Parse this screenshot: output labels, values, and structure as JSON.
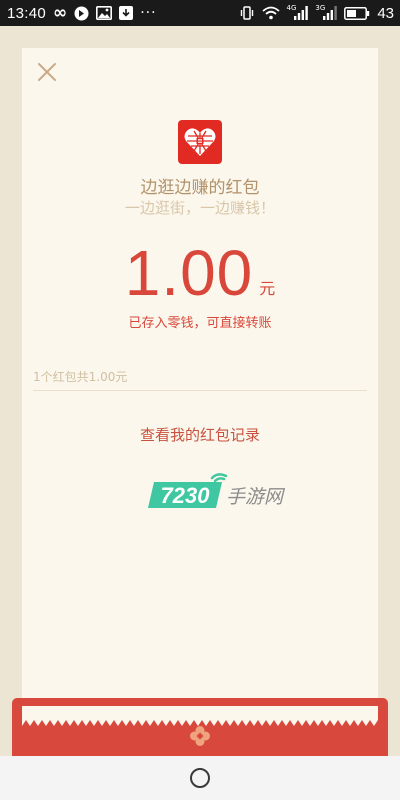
{
  "status_bar": {
    "time": "13:40",
    "battery": "43",
    "net_4g": "4G",
    "net_3g": "3G",
    "dots": "···"
  },
  "red_packet": {
    "title": "边逛边赚的红包",
    "subtitle": "一边逛街，一边赚钱！",
    "amount": "1.00",
    "currency": "元",
    "status": "已存入零钱，可直接转账",
    "summary": "1个红包共1.00元",
    "records_link": "查看我的红包记录"
  },
  "watermark": {
    "number": "7230",
    "text": "手游网"
  },
  "colors": {
    "accent_red": "#d9473b",
    "gold_text": "#b2926a",
    "paper": "#fbf7ec",
    "background": "#ece5d3",
    "watermark_green": "#3ec7a0"
  },
  "icons": {
    "close": "close-icon",
    "app_logo": "app-logo-icon",
    "home": "home-button"
  }
}
